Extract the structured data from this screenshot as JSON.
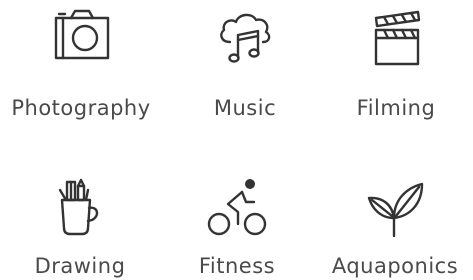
{
  "colors": {
    "icon_stroke": "#333333",
    "label_text": "#4a4a4a",
    "background": "#ffffff"
  },
  "tiles": [
    {
      "label": "Photography",
      "icon": "camera-icon"
    },
    {
      "label": "Music",
      "icon": "cloud-music-note-icon"
    },
    {
      "label": "Filming",
      "icon": "clapperboard-icon"
    },
    {
      "label": "Drawing",
      "icon": "brush-cup-icon"
    },
    {
      "label": "Fitness",
      "icon": "cyclist-icon"
    },
    {
      "label": "Aquaponics",
      "icon": "sprout-icon"
    }
  ]
}
